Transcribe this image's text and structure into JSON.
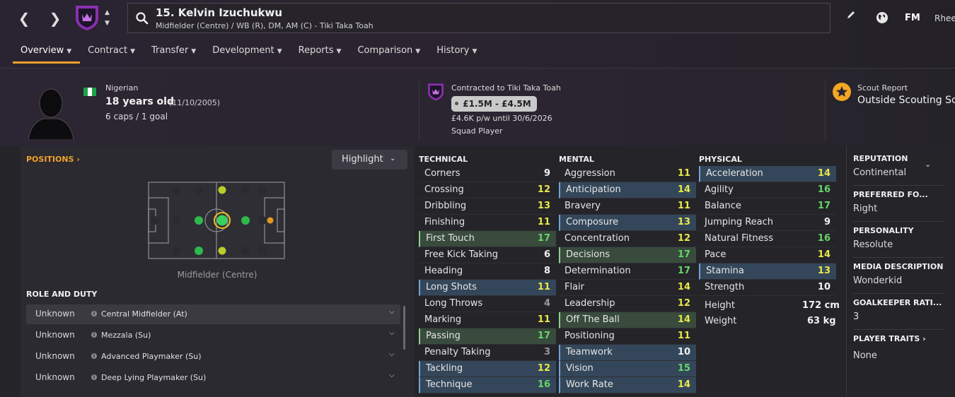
{
  "header": {
    "player_title": "15. Kelvin Izuchukwu",
    "player_subtitle": "Midfielder (Centre) / WB (R), DM, AM (C) - Tiki Taka Toah",
    "brand": "FM",
    "user": "Rhee"
  },
  "tabs": [
    {
      "label": "Overview",
      "active": true
    },
    {
      "label": "Contract"
    },
    {
      "label": "Transfer"
    },
    {
      "label": "Development"
    },
    {
      "label": "Reports"
    },
    {
      "label": "Comparison"
    },
    {
      "label": "History"
    }
  ],
  "profile": {
    "nationality": "Nigerian",
    "age": "18 years old",
    "dob": "(11/10/2005)",
    "caps": "6 caps / 1 goal"
  },
  "contract": {
    "club_line": "Contracted to Tiki Taka Toah",
    "value_range": "£1.5M - £4.5M",
    "wage_line": "£4.6K p/w until 30/6/2026",
    "status": "Squad Player"
  },
  "scout": {
    "title": "Scout Report",
    "value": "Outside Scouting Sco"
  },
  "positions": {
    "link_label": "POSITIONS",
    "highlight_label": "Highlight",
    "caption": "Midfielder (Centre)"
  },
  "roles": {
    "title": "ROLE AND DUTY",
    "items": [
      {
        "ability": "Unknown",
        "name": "Central Midfielder (At)"
      },
      {
        "ability": "Unknown",
        "name": "Mezzala (Su)"
      },
      {
        "ability": "Unknown",
        "name": "Advanced Playmaker (Su)"
      },
      {
        "ability": "Unknown",
        "name": "Deep Lying Playmaker (Su)"
      }
    ]
  },
  "attributes": {
    "technical": {
      "title": "TECHNICAL",
      "items": [
        {
          "name": "Corners",
          "value": "9"
        },
        {
          "name": "Crossing",
          "value": "12"
        },
        {
          "name": "Dribbling",
          "value": "13"
        },
        {
          "name": "Finishing",
          "value": "11"
        },
        {
          "name": "First Touch",
          "value": "17",
          "hl": "green"
        },
        {
          "name": "Free Kick Taking",
          "value": "6"
        },
        {
          "name": "Heading",
          "value": "8"
        },
        {
          "name": "Long Shots",
          "value": "11",
          "hl": "blue"
        },
        {
          "name": "Long Throws",
          "value": "4"
        },
        {
          "name": "Marking",
          "value": "11"
        },
        {
          "name": "Passing",
          "value": "17",
          "hl": "green"
        },
        {
          "name": "Penalty Taking",
          "value": "3"
        },
        {
          "name": "Tackling",
          "value": "12",
          "hl": "blue"
        },
        {
          "name": "Technique",
          "value": "16",
          "hl": "blue"
        }
      ]
    },
    "mental": {
      "title": "MENTAL",
      "items": [
        {
          "name": "Aggression",
          "value": "11"
        },
        {
          "name": "Anticipation",
          "value": "14",
          "hl": "blue"
        },
        {
          "name": "Bravery",
          "value": "11"
        },
        {
          "name": "Composure",
          "value": "13",
          "hl": "blue"
        },
        {
          "name": "Concentration",
          "value": "12"
        },
        {
          "name": "Decisions",
          "value": "17",
          "hl": "green"
        },
        {
          "name": "Determination",
          "value": "17"
        },
        {
          "name": "Flair",
          "value": "14"
        },
        {
          "name": "Leadership",
          "value": "12"
        },
        {
          "name": "Off The Ball",
          "value": "14",
          "hl": "green"
        },
        {
          "name": "Positioning",
          "value": "11"
        },
        {
          "name": "Teamwork",
          "value": "10",
          "hl": "blue"
        },
        {
          "name": "Vision",
          "value": "15",
          "hl": "blue"
        },
        {
          "name": "Work Rate",
          "value": "14",
          "hl": "blue"
        }
      ]
    },
    "physical": {
      "title": "PHYSICAL",
      "items": [
        {
          "name": "Acceleration",
          "value": "14",
          "hl": "blue"
        },
        {
          "name": "Agility",
          "value": "16"
        },
        {
          "name": "Balance",
          "value": "17"
        },
        {
          "name": "Jumping Reach",
          "value": "9"
        },
        {
          "name": "Natural Fitness",
          "value": "16"
        },
        {
          "name": "Pace",
          "value": "14"
        },
        {
          "name": "Stamina",
          "value": "13",
          "hl": "blue"
        },
        {
          "name": "Strength",
          "value": "10"
        }
      ],
      "height_label": "Height",
      "height": "172 cm",
      "weight_label": "Weight",
      "weight": "63 kg"
    }
  },
  "side": {
    "reputation_title": "REPUTATION",
    "reputation": "Continental",
    "foot_title": "PREFERRED FO...",
    "foot": "Right",
    "personality_title": "PERSONALITY",
    "personality": "Resolute",
    "media_title": "MEDIA DESCRIPTION",
    "media": "Wonderkid",
    "gk_title": "GOALKEEPER RATI...",
    "gk": "3",
    "traits_title": "PLAYER TRAITS",
    "traits": "None"
  },
  "colors": {
    "accent": "#f0a22a",
    "value_white": "#f2f2f2",
    "value_yellow": "#e8e84a",
    "value_green": "#66d66a",
    "value_grey": "#9a9a9a",
    "highlight_blue": "#34475a",
    "highlight_green": "#384b3c"
  }
}
